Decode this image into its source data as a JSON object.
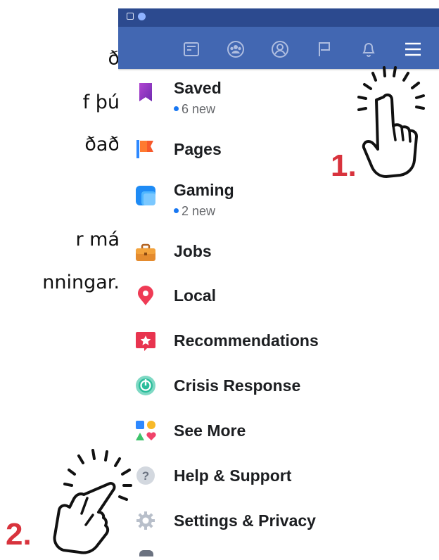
{
  "side_text": [
    "ð",
    "f þú",
    "ðað",
    "r má",
    "nningar."
  ],
  "menu": {
    "items": [
      {
        "label": "Saved",
        "sub": "6 new",
        "icon": "bookmark-icon"
      },
      {
        "label": "Pages",
        "icon": "flag-icon"
      },
      {
        "label": "Gaming",
        "sub": "2 new",
        "icon": "gaming-icon"
      },
      {
        "label": "Jobs",
        "icon": "briefcase-icon"
      },
      {
        "label": "Local",
        "icon": "location-pin-icon"
      },
      {
        "label": "Recommendations",
        "icon": "star-badge-icon"
      },
      {
        "label": "Crisis Response",
        "icon": "crisis-icon"
      },
      {
        "label": "See More",
        "icon": "shapes-icon"
      },
      {
        "label": "Help & Support",
        "icon": "question-icon"
      },
      {
        "label": "Settings & Privacy",
        "icon": "gear-icon"
      }
    ]
  },
  "nav_icons": [
    "news-feed-icon",
    "groups-icon",
    "profile-icon",
    "flag-icon",
    "bell-icon",
    "menu-icon"
  ],
  "annotations": {
    "step1": "1.",
    "step2": "2."
  },
  "colors": {
    "nav_bar": "#4267b2",
    "status_bar": "#2c4a8f",
    "step_red": "#d8333d",
    "new_dot": "#1877f2"
  }
}
